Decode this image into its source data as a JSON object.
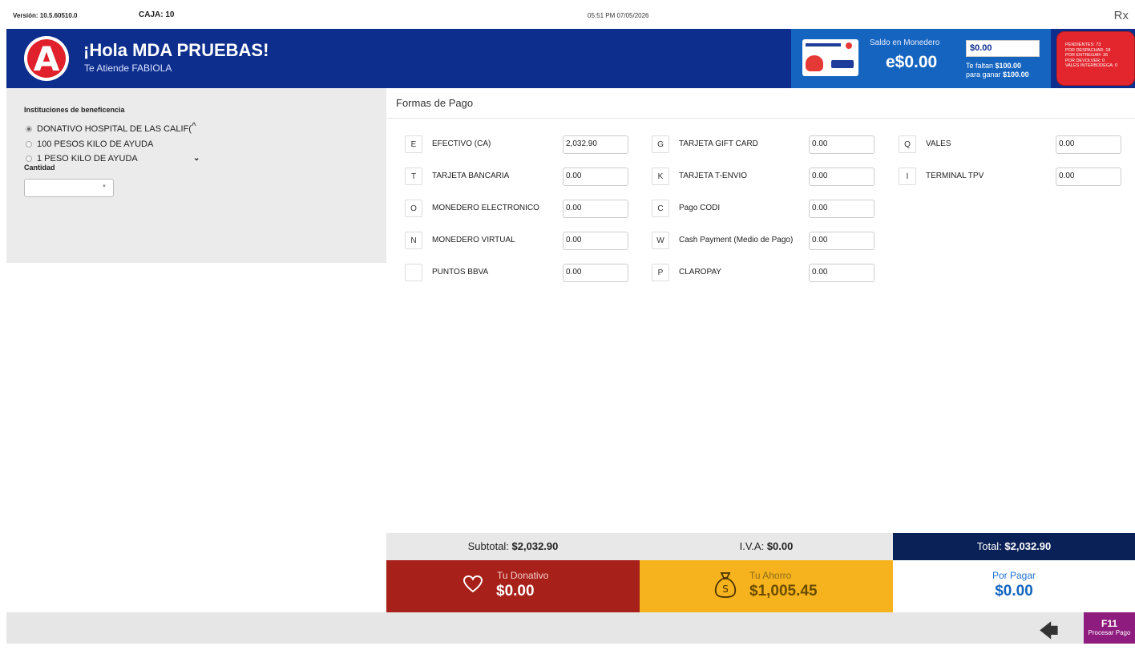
{
  "topbar": {
    "version": "Versión: 10.5.60510.0",
    "caja": "CAJA: 10",
    "datetime": "05:51 PM 07/05/2026",
    "rx_icon": "Rx"
  },
  "header": {
    "logo_letter": "A",
    "greeting": "¡Hola MDA PRUEBAS!",
    "attendant": "Te Atiende FABIOLA",
    "monedero": {
      "label": "Saldo en Monedero",
      "balance": "e$0.00",
      "input_value": "$0.00",
      "faltan_prefix": "Te faltan ",
      "faltan_amount": "$100.00",
      "ganar_prefix": "para ganar ",
      "ganar_amount": "$100.00"
    },
    "status_lines": [
      "PENDIENTES: 73",
      "POR DESPACHAR: 18",
      "POR ENTREGAR: 36",
      "POR DEVOLVER: 0",
      "VALES INTERBODEGA: 0"
    ]
  },
  "beneficencia": {
    "title": "Instituciones de beneficencia",
    "options": [
      "DONATIVO HOSPITAL DE LAS CALIF(",
      "100 PESOS KILO DE AYUDA",
      "1 PESO KILO DE AYUDA"
    ],
    "selected_index": 0,
    "cantidad_label": "Cantidad",
    "cantidad_value": ""
  },
  "formas": {
    "title": "Formas de Pago",
    "methods": [
      {
        "key": "E",
        "label": "EFECTIVO (CA)",
        "value": "2,032.90"
      },
      {
        "key": "T",
        "label": "TARJETA BANCARIA",
        "value": "0.00"
      },
      {
        "key": "O",
        "label": "MONEDERO ELECTRONICO",
        "value": "0.00"
      },
      {
        "key": "N",
        "label": "MONEDERO VIRTUAL",
        "value": "0.00"
      },
      {
        "key": "",
        "label": "PUNTOS BBVA",
        "value": "0.00"
      },
      {
        "key": "G",
        "label": "TARJETA GIFT CARD",
        "value": "0.00"
      },
      {
        "key": "K",
        "label": "TARJETA T-ENVIO",
        "value": "0.00"
      },
      {
        "key": "C",
        "label": "Pago CODI",
        "value": "0.00"
      },
      {
        "key": "W",
        "label": "Cash Payment (Medio de Pago)",
        "value": "0.00"
      },
      {
        "key": "P",
        "label": "CLAROPAY",
        "value": "0.00"
      },
      {
        "key": "Q",
        "label": "VALES",
        "value": "0.00"
      },
      {
        "key": "I",
        "label": "TERMINAL TPV",
        "value": "0.00"
      }
    ]
  },
  "totals": {
    "subtotal_label": "Subtotal: ",
    "subtotal": "$2,032.90",
    "iva_label": "I.V.A: ",
    "iva": "$0.00",
    "total_label": "Total: ",
    "total": "$2,032.90"
  },
  "summary": {
    "donativo_label": "Tu Donativo",
    "donativo": "$0.00",
    "ahorro_label": "Tu Ahorro",
    "ahorro": "$1,005.45",
    "por_pagar_label": "Por Pagar",
    "por_pagar": "$0.00"
  },
  "footer": {
    "f11_key": "F11",
    "f11_label": "Procesar Pago"
  },
  "colors": {
    "header_blue": "#0d2e8c",
    "donativo_red": "#a8201a",
    "ahorro_yellow": "#f7b31e",
    "total_navy": "#0a2157",
    "f11_purple": "#8e1b7e"
  }
}
